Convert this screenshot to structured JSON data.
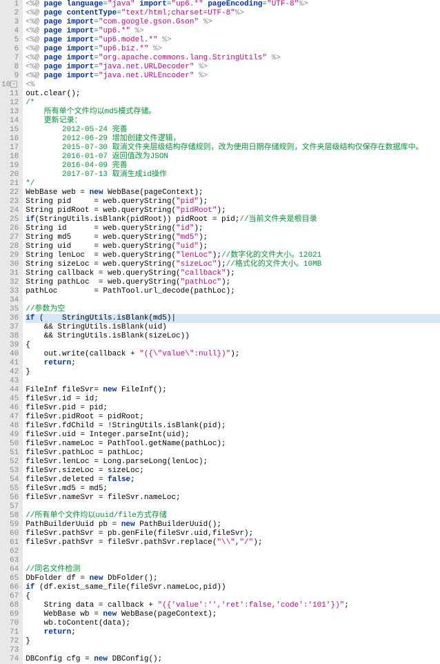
{
  "lines": [
    {
      "n": 1,
      "seg": [
        [
          "dlm",
          "<%@ "
        ],
        [
          "kw",
          "page"
        ],
        [
          "txt",
          " "
        ],
        [
          "kw",
          "language"
        ],
        [
          "op",
          "="
        ],
        [
          "str",
          "\"java\""
        ],
        [
          "txt",
          " "
        ],
        [
          "kw",
          "import"
        ],
        [
          "op",
          "="
        ],
        [
          "str",
          "\"up6.*\""
        ],
        [
          "txt",
          " "
        ],
        [
          "kw",
          "pageEncoding"
        ],
        [
          "op",
          "="
        ],
        [
          "str",
          "\"UTF-8\""
        ],
        [
          "dlm",
          "%>"
        ]
      ]
    },
    {
      "n": 2,
      "seg": [
        [
          "dlm",
          "<%@ "
        ],
        [
          "kw",
          "page"
        ],
        [
          "txt",
          " "
        ],
        [
          "kw",
          "contentType"
        ],
        [
          "op",
          "="
        ],
        [
          "str",
          "\"text/html;charset=UTF-8\""
        ],
        [
          "dlm",
          "%>"
        ]
      ]
    },
    {
      "n": 3,
      "seg": [
        [
          "dlm",
          "<%@ "
        ],
        [
          "kw",
          "page"
        ],
        [
          "txt",
          " "
        ],
        [
          "kw",
          "import"
        ],
        [
          "op",
          "="
        ],
        [
          "str",
          "\"com.google.gson.Gson\""
        ],
        [
          "txt",
          " "
        ],
        [
          "dlm",
          "%>"
        ]
      ]
    },
    {
      "n": 4,
      "seg": [
        [
          "dlm",
          "<%@ "
        ],
        [
          "kw",
          "page"
        ],
        [
          "txt",
          " "
        ],
        [
          "kw",
          "import"
        ],
        [
          "op",
          "="
        ],
        [
          "str",
          "\"up6.*\""
        ],
        [
          "txt",
          " "
        ],
        [
          "dlm",
          "%>"
        ]
      ]
    },
    {
      "n": 5,
      "seg": [
        [
          "dlm",
          "<%@ "
        ],
        [
          "kw",
          "page"
        ],
        [
          "txt",
          " "
        ],
        [
          "kw",
          "import"
        ],
        [
          "op",
          "="
        ],
        [
          "str",
          "\"up6.model.*\""
        ],
        [
          "txt",
          " "
        ],
        [
          "dlm",
          "%>"
        ]
      ]
    },
    {
      "n": 6,
      "seg": [
        [
          "dlm",
          "<%@ "
        ],
        [
          "kw",
          "page"
        ],
        [
          "txt",
          " "
        ],
        [
          "kw",
          "import"
        ],
        [
          "op",
          "="
        ],
        [
          "str",
          "\"up6.biz.*\""
        ],
        [
          "txt",
          " "
        ],
        [
          "dlm",
          "%>"
        ]
      ]
    },
    {
      "n": 7,
      "seg": [
        [
          "dlm",
          "<%@ "
        ],
        [
          "kw",
          "page"
        ],
        [
          "txt",
          " "
        ],
        [
          "kw",
          "import"
        ],
        [
          "op",
          "="
        ],
        [
          "str",
          "\"org.apache.commons.lang.StringUtils\""
        ],
        [
          "txt",
          " "
        ],
        [
          "dlm",
          "%>"
        ]
      ]
    },
    {
      "n": 8,
      "seg": [
        [
          "dlm",
          "<%@ "
        ],
        [
          "kw",
          "page"
        ],
        [
          "txt",
          " "
        ],
        [
          "kw",
          "import"
        ],
        [
          "op",
          "="
        ],
        [
          "str",
          "\"java.net.URLDecoder\""
        ],
        [
          "txt",
          " "
        ],
        [
          "dlm",
          "%>"
        ]
      ]
    },
    {
      "n": 9,
      "seg": [
        [
          "dlm",
          "<%@ "
        ],
        [
          "kw",
          "page"
        ],
        [
          "txt",
          " "
        ],
        [
          "kw",
          "import"
        ],
        [
          "op",
          "="
        ],
        [
          "str",
          "\"java.net.URLEncoder\""
        ],
        [
          "txt",
          " "
        ],
        [
          "dlm",
          "%>"
        ]
      ]
    },
    {
      "n": 10,
      "fold": "-",
      "seg": [
        [
          "dlm",
          "<%"
        ]
      ]
    },
    {
      "n": 11,
      "seg": [
        [
          "txt",
          "out.clear();"
        ]
      ]
    },
    {
      "n": 12,
      "seg": [
        [
          "cmt",
          "/*"
        ]
      ]
    },
    {
      "n": 13,
      "seg": [
        [
          "cmt",
          "    所有单个文件均以md5模式存储。"
        ]
      ]
    },
    {
      "n": 14,
      "seg": [
        [
          "cmt",
          "    更新记录："
        ]
      ]
    },
    {
      "n": 15,
      "seg": [
        [
          "cmt",
          "        2012-05-24 完善"
        ]
      ]
    },
    {
      "n": 16,
      "seg": [
        [
          "cmt",
          "        2012-06-29 增加创建文件逻辑，"
        ]
      ]
    },
    {
      "n": 17,
      "seg": [
        [
          "cmt",
          "        2015-07-30 取消文件夹层级结构存储规则，改为使用日期存储规则，文件夹层级结构仅保存在数据库中。"
        ]
      ]
    },
    {
      "n": 18,
      "seg": [
        [
          "cmt",
          "        2016-01-07 返回值改为JSON"
        ]
      ]
    },
    {
      "n": 19,
      "seg": [
        [
          "cmt",
          "        2016-04-09 完善"
        ]
      ]
    },
    {
      "n": 20,
      "seg": [
        [
          "cmt",
          "        2017-07-13 取消生成id操作"
        ]
      ]
    },
    {
      "n": 21,
      "seg": [
        [
          "cmt",
          "*/"
        ]
      ]
    },
    {
      "n": 22,
      "seg": [
        [
          "txt",
          "WebBase web = "
        ],
        [
          "kw",
          "new"
        ],
        [
          "txt",
          " WebBase(pageContext);"
        ]
      ]
    },
    {
      "n": 23,
      "seg": [
        [
          "txt",
          "String pid     = web.queryString("
        ],
        [
          "str",
          "\"pid\""
        ],
        [
          "txt",
          ");"
        ]
      ]
    },
    {
      "n": 24,
      "seg": [
        [
          "txt",
          "String pidRoot = web.queryString("
        ],
        [
          "str",
          "\"pidRoot\""
        ],
        [
          "txt",
          ");"
        ]
      ]
    },
    {
      "n": 25,
      "seg": [
        [
          "kw",
          "if"
        ],
        [
          "txt",
          "(StringUtils.isBlank(pidRoot)) pidRoot = pid;"
        ],
        [
          "cmt",
          "//当前文件夹是根目录"
        ]
      ]
    },
    {
      "n": 26,
      "seg": [
        [
          "txt",
          "String id      = web.queryString("
        ],
        [
          "str",
          "\"id\""
        ],
        [
          "txt",
          ");"
        ]
      ]
    },
    {
      "n": 27,
      "seg": [
        [
          "txt",
          "String md5     = web.queryString("
        ],
        [
          "str",
          "\"md5\""
        ],
        [
          "txt",
          ");"
        ]
      ]
    },
    {
      "n": 28,
      "seg": [
        [
          "txt",
          "String uid     = web.queryString("
        ],
        [
          "str",
          "\"uid\""
        ],
        [
          "txt",
          ");"
        ]
      ]
    },
    {
      "n": 29,
      "seg": [
        [
          "txt",
          "String lenLoc  = web.queryString("
        ],
        [
          "str",
          "\"lenLoc\""
        ],
        [
          "txt",
          ");"
        ],
        [
          "cmt",
          "//数字化的文件大小。12021"
        ]
      ]
    },
    {
      "n": 30,
      "seg": [
        [
          "txt",
          "String sizeLoc = web.queryString("
        ],
        [
          "str",
          "\"sizeLoc\""
        ],
        [
          "txt",
          ");"
        ],
        [
          "cmt",
          "//格式化的文件大小。10MB"
        ]
      ]
    },
    {
      "n": 31,
      "seg": [
        [
          "txt",
          "String callback = web.queryString("
        ],
        [
          "str",
          "\"callback\""
        ],
        [
          "txt",
          ");"
        ]
      ]
    },
    {
      "n": 32,
      "seg": [
        [
          "txt",
          "String pathLoc  = web.queryString("
        ],
        [
          "str",
          "\"pathLoc\""
        ],
        [
          "txt",
          ");"
        ]
      ]
    },
    {
      "n": 33,
      "seg": [
        [
          "txt",
          "pathLoc        = PathTool.url_decode(pathLoc);"
        ]
      ]
    },
    {
      "n": 34,
      "seg": [
        [
          "txt",
          ""
        ]
      ]
    },
    {
      "n": 35,
      "seg": [
        [
          "cmt",
          "//参数为空"
        ]
      ]
    },
    {
      "n": 36,
      "hl": true,
      "seg": [
        [
          "kw",
          "if"
        ],
        [
          "txt",
          " (    StringUtils.isBlank(md5)|"
        ]
      ]
    },
    {
      "n": 37,
      "seg": [
        [
          "txt",
          "    && StringUtils.isBlank(uid)"
        ]
      ]
    },
    {
      "n": 38,
      "seg": [
        [
          "txt",
          "    && StringUtils.isBlank(sizeLoc))"
        ]
      ]
    },
    {
      "n": 39,
      "seg": [
        [
          "txt",
          "{"
        ]
      ]
    },
    {
      "n": 40,
      "seg": [
        [
          "txt",
          "    out.write(callback + "
        ],
        [
          "str",
          "\"({\\\"value\\\":null})\""
        ],
        [
          "txt",
          ");"
        ]
      ]
    },
    {
      "n": 41,
      "seg": [
        [
          "txt",
          "    "
        ],
        [
          "kw",
          "return"
        ],
        [
          "txt",
          ";"
        ]
      ]
    },
    {
      "n": 42,
      "seg": [
        [
          "txt",
          "}"
        ]
      ]
    },
    {
      "n": 43,
      "seg": [
        [
          "txt",
          ""
        ]
      ]
    },
    {
      "n": 44,
      "seg": [
        [
          "txt",
          "FileInf fileSvr= "
        ],
        [
          "kw",
          "new"
        ],
        [
          "txt",
          " FileInf();"
        ]
      ]
    },
    {
      "n": 45,
      "seg": [
        [
          "txt",
          "fileSvr.id = id;"
        ]
      ]
    },
    {
      "n": 46,
      "seg": [
        [
          "txt",
          "fileSvr.pid = pid;"
        ]
      ]
    },
    {
      "n": 47,
      "seg": [
        [
          "txt",
          "fileSvr.pidRoot = pidRoot;"
        ]
      ]
    },
    {
      "n": 48,
      "seg": [
        [
          "txt",
          "fileSvr.fdChild = !StringUtils.isBlank(pid);"
        ]
      ]
    },
    {
      "n": 49,
      "seg": [
        [
          "txt",
          "fileSvr.uid = Integer.parseInt(uid);"
        ]
      ]
    },
    {
      "n": 50,
      "seg": [
        [
          "txt",
          "fileSvr.nameLoc = PathTool.getName(pathLoc);"
        ]
      ]
    },
    {
      "n": 51,
      "seg": [
        [
          "txt",
          "fileSvr.pathLoc = pathLoc;"
        ]
      ]
    },
    {
      "n": 52,
      "seg": [
        [
          "txt",
          "fileSvr.lenLoc = Long.parseLong(lenLoc);"
        ]
      ]
    },
    {
      "n": 53,
      "seg": [
        [
          "txt",
          "fileSvr.sizeLoc = sizeLoc;"
        ]
      ]
    },
    {
      "n": 54,
      "seg": [
        [
          "txt",
          "fileSvr.deleted = "
        ],
        [
          "kw",
          "false"
        ],
        [
          "txt",
          ";"
        ]
      ]
    },
    {
      "n": 55,
      "seg": [
        [
          "txt",
          "fileSvr.md5 = md5;"
        ]
      ]
    },
    {
      "n": 56,
      "seg": [
        [
          "txt",
          "fileSvr.nameSvr = fileSvr.nameLoc;"
        ]
      ]
    },
    {
      "n": 57,
      "seg": [
        [
          "txt",
          ""
        ]
      ]
    },
    {
      "n": 58,
      "seg": [
        [
          "cmt",
          "//所有单个文件均以uuid/file方式存储"
        ]
      ]
    },
    {
      "n": 59,
      "seg": [
        [
          "txt",
          "PathBuilderUuid pb = "
        ],
        [
          "kw",
          "new"
        ],
        [
          "txt",
          " PathBuilderUuid();"
        ]
      ]
    },
    {
      "n": 60,
      "seg": [
        [
          "txt",
          "fileSvr.pathSvr = pb.genFile(fileSvr.uid,fileSvr);"
        ]
      ]
    },
    {
      "n": 61,
      "seg": [
        [
          "txt",
          "fileSvr.pathSvr = fileSvr.pathSvr.replace("
        ],
        [
          "str",
          "\"\\\\\""
        ],
        [
          "txt",
          ","
        ],
        [
          "str",
          "\"/\""
        ],
        [
          "txt",
          ");"
        ]
      ]
    },
    {
      "n": 62,
      "seg": [
        [
          "txt",
          ""
        ]
      ]
    },
    {
      "n": 63,
      "seg": [
        [
          "txt",
          ""
        ]
      ]
    },
    {
      "n": 64,
      "seg": [
        [
          "cmt",
          "//同名文件检测"
        ]
      ]
    },
    {
      "n": 65,
      "seg": [
        [
          "txt",
          "DbFolder df = "
        ],
        [
          "kw",
          "new"
        ],
        [
          "txt",
          " DbFolder();"
        ]
      ]
    },
    {
      "n": 66,
      "seg": [
        [
          "kw",
          "if"
        ],
        [
          "txt",
          " (df.exist_same_file(fileSvr.nameLoc,pid))"
        ]
      ]
    },
    {
      "n": 67,
      "seg": [
        [
          "txt",
          "{"
        ]
      ]
    },
    {
      "n": 68,
      "seg": [
        [
          "txt",
          "    String data = callback + "
        ],
        [
          "str",
          "\"({'value':'','ret':false,'code':'101'})\""
        ],
        [
          "txt",
          ";"
        ]
      ]
    },
    {
      "n": 69,
      "seg": [
        [
          "txt",
          "    WebBase wb = "
        ],
        [
          "kw",
          "new"
        ],
        [
          "txt",
          " WebBase(pageContext);"
        ]
      ]
    },
    {
      "n": 70,
      "seg": [
        [
          "txt",
          "    wb.toContent(data);"
        ]
      ]
    },
    {
      "n": 71,
      "seg": [
        [
          "txt",
          "    "
        ],
        [
          "kw",
          "return"
        ],
        [
          "txt",
          ";"
        ]
      ]
    },
    {
      "n": 72,
      "seg": [
        [
          "txt",
          "}"
        ]
      ]
    },
    {
      "n": 73,
      "seg": [
        [
          "txt",
          ""
        ]
      ]
    },
    {
      "n": 74,
      "seg": [
        [
          "txt",
          "DBConfig cfg = "
        ],
        [
          "kw",
          "new"
        ],
        [
          "txt",
          " DBConfig();"
        ]
      ]
    }
  ]
}
